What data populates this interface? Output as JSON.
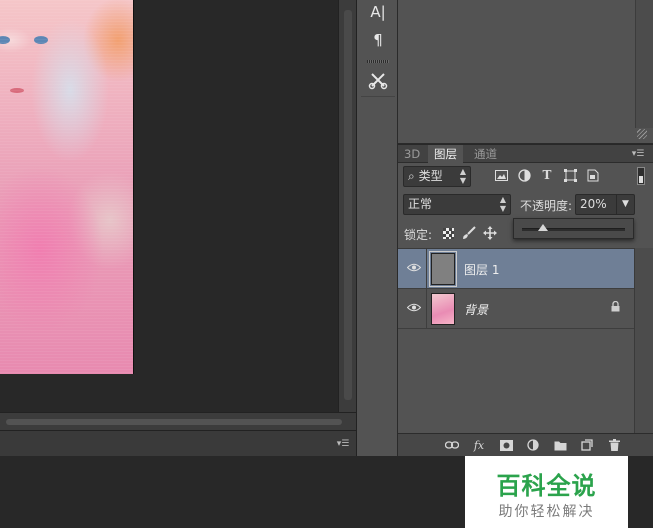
{
  "tools": {
    "type_tool_label": "A|",
    "paragraph_label": "¶",
    "tool_icon": "scissors-wrench-icon"
  },
  "layers_panel": {
    "tabs": [
      "3D",
      "图层",
      "通道"
    ],
    "active_tab": "图层",
    "filter": {
      "selected": "类型",
      "search_icon": "search-icon"
    },
    "filter_icons": [
      "image-icon",
      "adjustment-icon",
      "text-icon",
      "shape-icon",
      "smart-object-icon"
    ],
    "blend_mode": "正常",
    "opacity_label": "不透明度:",
    "opacity_value": "20%",
    "opacity_slider_fraction": 0.2,
    "lock_label": "锁定:",
    "layers": [
      {
        "name": "图层 1",
        "selected": true,
        "visible": true,
        "locked": false
      },
      {
        "name": "背景",
        "selected": false,
        "visible": true,
        "locked": true
      }
    ],
    "bottom_icons": [
      "link-icon",
      "fx-icon",
      "mask-icon",
      "adjustment-layer-icon",
      "folder-icon",
      "new-layer-icon",
      "trash-icon"
    ],
    "fx_label": "fx"
  },
  "watermark": {
    "title": "百科全说",
    "subtitle": "助你轻松解决"
  },
  "colors": {
    "panel_bg": "#535353",
    "selected_row": "#6f7f96",
    "watermark_green": "#2ba34c"
  }
}
